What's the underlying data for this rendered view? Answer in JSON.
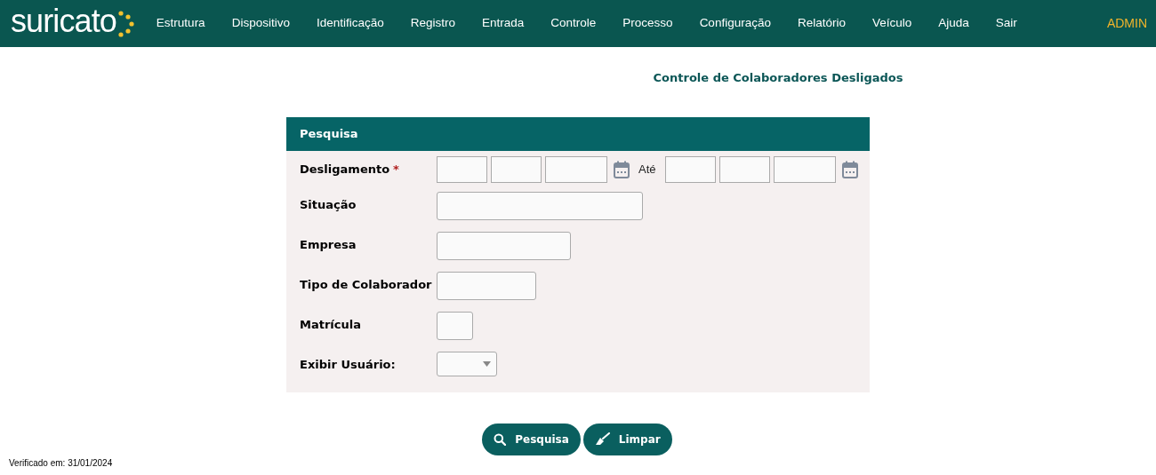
{
  "logo": "suricato",
  "nav": [
    {
      "label": "Estrutura"
    },
    {
      "label": "Dispositivo"
    },
    {
      "label": "Identificação"
    },
    {
      "label": "Registro"
    },
    {
      "label": "Entrada"
    },
    {
      "label": "Controle"
    },
    {
      "label": "Processo"
    },
    {
      "label": "Configuração"
    },
    {
      "label": "Relatório"
    },
    {
      "label": "Veículo"
    },
    {
      "label": "Ajuda"
    },
    {
      "label": "Sair"
    }
  ],
  "user": "ADMIN",
  "page_title": "Controle de Colaboradores Desligados",
  "panel": {
    "title": "Pesquisa",
    "fields": [
      {
        "label": "Desligamento",
        "required_mark": "*",
        "kind": "date_range",
        "separator": "Até"
      },
      {
        "label": "Situação",
        "kind": "text"
      },
      {
        "label": "Empresa",
        "kind": "text"
      },
      {
        "label": "Tipo de Colaborador",
        "kind": "text"
      },
      {
        "label": "Matrícula",
        "kind": "text"
      },
      {
        "label": "Exibir Usuário:",
        "kind": "select"
      }
    ]
  },
  "buttons": [
    {
      "label": "Pesquisa",
      "kind": "search"
    },
    {
      "label": "Limpar",
      "kind": "clear"
    }
  ],
  "footer": "Verificado em: 31/01/2024"
}
